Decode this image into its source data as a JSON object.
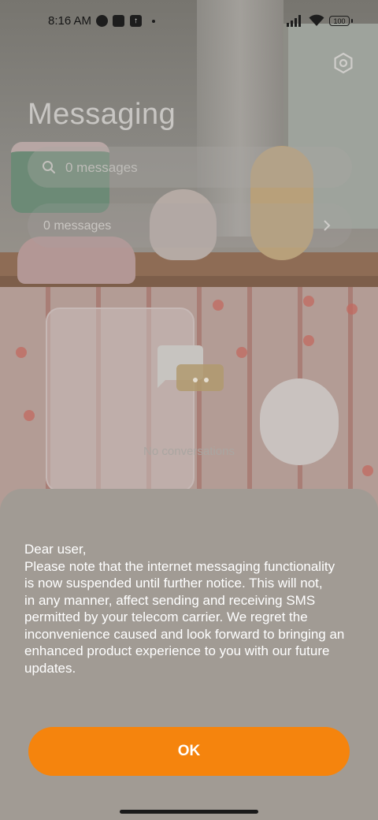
{
  "status_bar": {
    "time": "8:16 AM",
    "battery": "100",
    "icons": [
      "whatsapp-icon",
      "square-app-icon",
      "upload-icon",
      "dot-icon",
      "signal-icon",
      "wifi-icon",
      "battery-icon"
    ]
  },
  "app": {
    "title": "Messaging",
    "search_placeholder": "0 messages",
    "row_text": "0 messages",
    "empty_text": "No conversations"
  },
  "dialog": {
    "message_lines": [
      "Dear user,",
      "Please note that the internet messaging functionality",
      "is now suspended until further notice. This will not,",
      "in any manner, affect sending and receiving SMS",
      "permitted by your telecom carrier. We regret the",
      "inconvenience caused and look forward to bringing an",
      "enhanced product experience to you with our future",
      "updates."
    ],
    "ok_label": "OK"
  },
  "colors": {
    "accent": "#f5840d",
    "sheet": "#a19b94"
  }
}
